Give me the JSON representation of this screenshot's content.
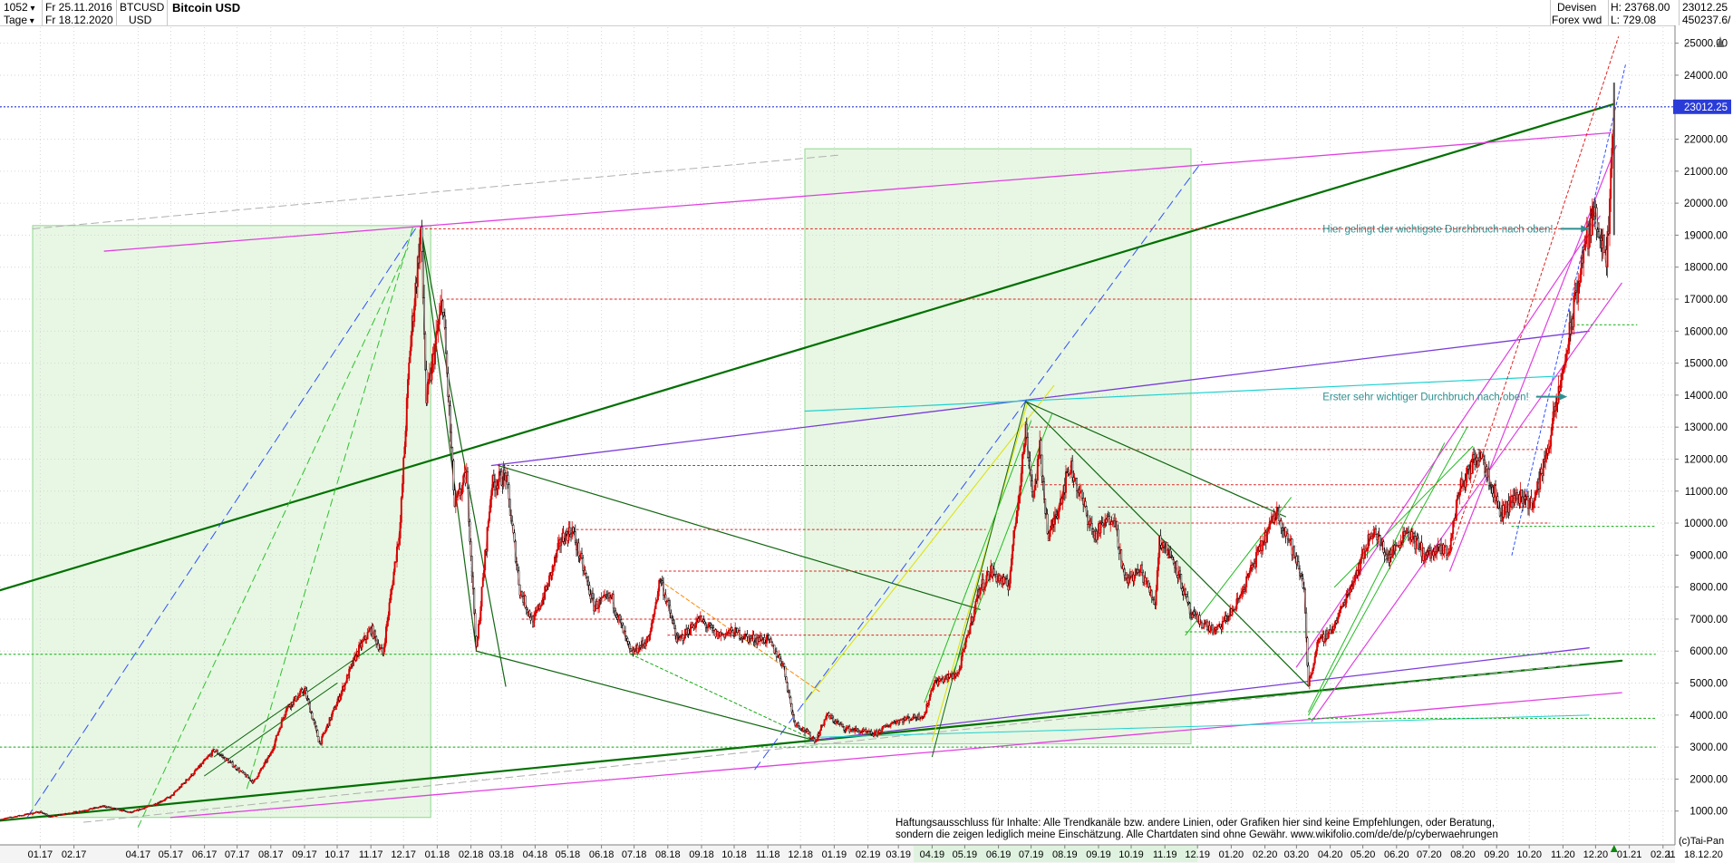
{
  "header": {
    "bar_count": "1052",
    "from_date": "Fr 25.11.2016",
    "to_date": "Fr 18.12.2020",
    "interval": "Tage",
    "symbol": "BTCUSD",
    "currency": "USD",
    "name": "Bitcoin USD",
    "category": "Devisen",
    "source": "Forex vwd",
    "high": "H: 23768.00",
    "low": "L: 729.08",
    "last": "23012.25",
    "volume": "450237.6/"
  },
  "chart_data": {
    "type": "line",
    "title": "Bitcoin USD",
    "y_scale": "linear",
    "ylim": [
      0,
      25500
    ],
    "y_ticks": [
      1000,
      2000,
      3000,
      4000,
      5000,
      6000,
      7000,
      8000,
      9000,
      10000,
      11000,
      12000,
      13000,
      14000,
      15000,
      16000,
      17000,
      18000,
      19000,
      20000,
      21000,
      22000,
      23000,
      24000,
      25000
    ],
    "y_tick_labels": [
      "1000.00",
      "2000.00",
      "3000.00",
      "4000.00",
      "5000.00",
      "6000.00",
      "7000.00",
      "8000.00",
      "9000.00",
      "10000.00",
      "11000.00",
      "12000.00",
      "13000.00",
      "14000.00",
      "15000.00",
      "16000.00",
      "17000.00",
      "18000.00",
      "19000.00",
      "20000.00",
      "21000.00",
      "22000.00",
      "23000.00",
      "24000.00",
      "25000.00"
    ],
    "x_labels": [
      "01.17",
      "02.17",
      "04.17",
      "05.17",
      "06.17",
      "07.17",
      "08.17",
      "09.17",
      "10.17",
      "11.17",
      "12.17",
      "01.18",
      "02.18",
      "03.18",
      "04.18",
      "05.18",
      "06.18",
      "07.18",
      "08.18",
      "09.18",
      "10.18",
      "11.18",
      "12.18",
      "01.19",
      "02.19",
      "03.19",
      "04.19",
      "05.19",
      "06.19",
      "07.19",
      "08.19",
      "09.19",
      "10.19",
      "11.19",
      "12.19",
      "01.20",
      "02.20",
      "03.20",
      "04.20",
      "05.20",
      "06.20",
      "07.20",
      "08.20",
      "09.20",
      "10.20",
      "11.20",
      "12.20",
      "01.21",
      "02.21"
    ],
    "x_label_dates": [
      "2017-01-01",
      "2017-02-01",
      "2017-04-01",
      "2017-05-01",
      "2017-06-01",
      "2017-07-01",
      "2017-08-01",
      "2017-09-01",
      "2017-10-01",
      "2017-11-01",
      "2017-12-01",
      "2018-01-01",
      "2018-02-01",
      "2018-03-01",
      "2018-04-01",
      "2018-05-01",
      "2018-06-01",
      "2018-07-01",
      "2018-08-01",
      "2018-09-01",
      "2018-10-01",
      "2018-11-01",
      "2018-12-01",
      "2019-01-01",
      "2019-02-01",
      "2019-03-01",
      "2019-04-01",
      "2019-05-01",
      "2019-06-01",
      "2019-07-01",
      "2019-08-01",
      "2019-09-01",
      "2019-10-01",
      "2019-11-01",
      "2019-12-01",
      "2020-01-01",
      "2020-02-01",
      "2020-03-01",
      "2020-04-01",
      "2020-05-01",
      "2020-06-01",
      "2020-07-01",
      "2020-08-01",
      "2020-09-01",
      "2020-10-01",
      "2020-11-01",
      "2020-12-01",
      "2021-01-01",
      "2021-02-01"
    ],
    "x_last_label": "18.12.20",
    "last_value": 23012.25,
    "last_value_label": "23012.25",
    "series": [
      {
        "color": "#dd0000",
        "points": [
          [
            "2016-11-25",
            740
          ],
          [
            "2017-01-01",
            980
          ],
          [
            "2017-01-10",
            820
          ],
          [
            "2017-02-01",
            960
          ],
          [
            "2017-03-01",
            1150
          ],
          [
            "2017-03-25",
            950
          ],
          [
            "2017-04-15",
            1200
          ],
          [
            "2017-05-01",
            1450
          ],
          [
            "2017-05-25",
            2300
          ],
          [
            "2017-06-10",
            2900
          ],
          [
            "2017-06-25",
            2500
          ],
          [
            "2017-07-16",
            1900
          ],
          [
            "2017-08-01",
            2800
          ],
          [
            "2017-08-15",
            4200
          ],
          [
            "2017-09-01",
            4800
          ],
          [
            "2017-09-15",
            3100
          ],
          [
            "2017-10-01",
            4400
          ],
          [
            "2017-10-20",
            6000
          ],
          [
            "2017-11-01",
            6700
          ],
          [
            "2017-11-12",
            5900
          ],
          [
            "2017-11-28",
            10000
          ],
          [
            "2017-12-07",
            15500
          ],
          [
            "2017-12-17",
            19200
          ],
          [
            "2017-12-22",
            13800
          ],
          [
            "2018-01-06",
            17000
          ],
          [
            "2018-01-17",
            10500
          ],
          [
            "2018-01-28",
            11500
          ],
          [
            "2018-02-06",
            6000
          ],
          [
            "2018-02-20",
            11200
          ],
          [
            "2018-03-05",
            11500
          ],
          [
            "2018-03-18",
            7900
          ],
          [
            "2018-03-30",
            6900
          ],
          [
            "2018-04-12",
            8000
          ],
          [
            "2018-04-25",
            9500
          ],
          [
            "2018-05-05",
            9800
          ],
          [
            "2018-05-25",
            7400
          ],
          [
            "2018-06-10",
            7700
          ],
          [
            "2018-06-28",
            5900
          ],
          [
            "2018-07-15",
            6400
          ],
          [
            "2018-07-25",
            8300
          ],
          [
            "2018-08-10",
            6300
          ],
          [
            "2018-08-30",
            7000
          ],
          [
            "2018-09-15",
            6500
          ],
          [
            "2018-10-01",
            6600
          ],
          [
            "2018-10-15",
            6400
          ],
          [
            "2018-11-01",
            6350
          ],
          [
            "2018-11-15",
            5600
          ],
          [
            "2018-11-25",
            3800
          ],
          [
            "2018-12-15",
            3200
          ],
          [
            "2018-12-25",
            4000
          ],
          [
            "2019-01-10",
            3600
          ],
          [
            "2019-02-07",
            3400
          ],
          [
            "2019-02-25",
            3800
          ],
          [
            "2019-03-25",
            4000
          ],
          [
            "2019-04-02",
            5000
          ],
          [
            "2019-04-25",
            5300
          ],
          [
            "2019-05-14",
            7900
          ],
          [
            "2019-05-25",
            8500
          ],
          [
            "2019-06-10",
            8000
          ],
          [
            "2019-06-26",
            12900
          ],
          [
            "2019-07-03",
            10800
          ],
          [
            "2019-07-09",
            12300
          ],
          [
            "2019-07-17",
            9500
          ],
          [
            "2019-08-06",
            11800
          ],
          [
            "2019-08-28",
            9600
          ],
          [
            "2019-09-15",
            10300
          ],
          [
            "2019-09-25",
            8200
          ],
          [
            "2019-10-10",
            8500
          ],
          [
            "2019-10-23",
            7500
          ],
          [
            "2019-10-27",
            9500
          ],
          [
            "2019-11-10",
            8800
          ],
          [
            "2019-11-25",
            7100
          ],
          [
            "2019-12-18",
            6600
          ],
          [
            "2020-01-05",
            7400
          ],
          [
            "2020-01-20",
            8600
          ],
          [
            "2020-02-12",
            10400
          ],
          [
            "2020-02-25",
            9300
          ],
          [
            "2020-03-08",
            8000
          ],
          [
            "2020-03-12",
            4900
          ],
          [
            "2020-03-20",
            6200
          ],
          [
            "2020-04-05",
            6800
          ],
          [
            "2020-04-29",
            8800
          ],
          [
            "2020-05-10",
            9800
          ],
          [
            "2020-05-25",
            8900
          ],
          [
            "2020-06-10",
            9800
          ],
          [
            "2020-06-27",
            9000
          ],
          [
            "2020-07-20",
            9200
          ],
          [
            "2020-07-28",
            11000
          ],
          [
            "2020-08-17",
            12300
          ],
          [
            "2020-09-05",
            10300
          ],
          [
            "2020-09-20",
            10900
          ],
          [
            "2020-10-05",
            10600
          ],
          [
            "2020-10-21",
            12800
          ],
          [
            "2020-11-05",
            15500
          ],
          [
            "2020-11-20",
            18500
          ],
          [
            "2020-12-01",
            19800
          ],
          [
            "2020-12-11",
            18000
          ],
          [
            "2020-12-16",
            21300
          ],
          [
            "2020-12-18",
            23012
          ]
        ]
      }
    ],
    "annotations": [
      {
        "text": "Hier gelingt der wichtigste Durchbruch nach oben!",
        "x": "2020-03-25",
        "y": 19200,
        "color": "#2f8f8f",
        "arrow_to": [
          "2020-11-25",
          19200
        ]
      },
      {
        "text": "Erster sehr wichtiger Durchbruch nach oben!",
        "x": "2020-03-25",
        "y": 13950,
        "color": "#2f8f8f",
        "arrow_to": [
          "2020-11-05",
          13950
        ]
      }
    ],
    "drawing_colors": {
      "candle_up": "#dd0000",
      "candle_down": "#000000",
      "trend_dark_green": "#007000",
      "trend_green": "#22bb22",
      "trend_magenta": "#e040e0",
      "trend_violet": "#7a3cd8",
      "trend_cyan": "#20d0d0",
      "trend_yellow": "#e0e000",
      "trend_blue": "#3050ff",
      "level_red": "#dd2222",
      "level_green": "#11aa11",
      "zone_fill": "#e7f7e3",
      "last_line": "#2a3cd8",
      "last_tag": "#2a3cd8"
    }
  },
  "disclaimer": {
    "line1": "Haftungsausschluss für Inhalte: Alle Trendkanäle bzw. andere Linien, oder Grafiken hier sind keine Empfehlungen, oder Beratung,",
    "line2": "sondern die zeigen lediglich meine  Einschätzung. Alle Chartdaten sind ohne Gewähr.  www.wikifolio.com/de/de/p/cyberwaehrungen",
    "credit": "(c)Tai-Pan",
    "mode_mark": "L"
  }
}
